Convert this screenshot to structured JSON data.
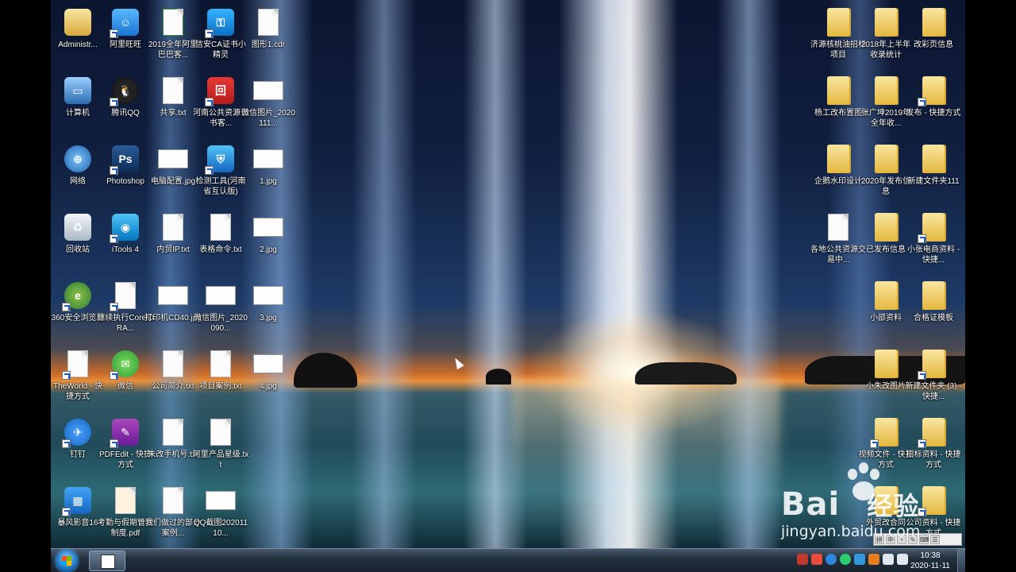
{
  "watermark": {
    "brand": "Bai",
    "brand_suffix": "经验",
    "url": "jingyan.baidu.com"
  },
  "taskbar": {
    "time": "10:38",
    "date": "2020-11-11"
  },
  "language_bar": {
    "items": [
      "拼",
      "中",
      "・",
      "✎",
      "⌨",
      "☰"
    ]
  },
  "desktop_icons": [
    {
      "label": "Administr...",
      "icon": "user-folder-icon",
      "col": 0,
      "row": 0
    },
    {
      "label": "阿里旺旺",
      "icon": "aliwangwang-icon",
      "col": 1,
      "row": 0
    },
    {
      "label": "2019全年阿里巴巴客...",
      "icon": "excel-file-icon",
      "col": 2,
      "row": 0
    },
    {
      "label": "信安CA证书小精灵",
      "icon": "key-icon",
      "col": 3,
      "row": 0
    },
    {
      "label": "图形1.cdr",
      "icon": "file-icon",
      "col": 4,
      "row": 0
    },
    {
      "label": "计算机",
      "icon": "computer-icon",
      "col": 0,
      "row": 1
    },
    {
      "label": "腾讯QQ",
      "icon": "qq-icon",
      "col": 1,
      "row": 1
    },
    {
      "label": "共享.txt",
      "icon": "text-file-icon",
      "col": 2,
      "row": 1
    },
    {
      "label": "河南公共资源证书客...",
      "icon": "certificate-app-icon",
      "col": 3,
      "row": 1
    },
    {
      "label": "微信图片_2020111...",
      "icon": "image-file-icon",
      "col": 4,
      "row": 1
    },
    {
      "label": "网络",
      "icon": "network-icon",
      "col": 0,
      "row": 2
    },
    {
      "label": "Photoshop",
      "icon": "photoshop-icon",
      "col": 1,
      "row": 2
    },
    {
      "label": "电脑配置.jpg",
      "icon": "image-file-icon",
      "col": 2,
      "row": 2
    },
    {
      "label": "检测工具(河南省互认版)",
      "icon": "shield-app-icon",
      "col": 3,
      "row": 2
    },
    {
      "label": "1.jpg",
      "icon": "image-file-icon",
      "col": 4,
      "row": 2
    },
    {
      "label": "回收站",
      "icon": "recycle-bin-icon",
      "col": 0,
      "row": 3
    },
    {
      "label": "iTools 4",
      "icon": "itools-icon",
      "col": 1,
      "row": 3
    },
    {
      "label": "内贸IP.txt",
      "icon": "text-file-icon",
      "col": 2,
      "row": 3
    },
    {
      "label": "表格命令.txt",
      "icon": "text-file-icon",
      "col": 3,
      "row": 3
    },
    {
      "label": "2.jpg",
      "icon": "image-file-icon",
      "col": 4,
      "row": 3
    },
    {
      "label": "360安全浏览器",
      "icon": "browser-360-icon",
      "col": 0,
      "row": 4
    },
    {
      "label": "继续执行CorelDRA...",
      "icon": "app-window-icon",
      "col": 1,
      "row": 4
    },
    {
      "label": "打印机CD40.jpg",
      "icon": "image-file-icon",
      "col": 2,
      "row": 4
    },
    {
      "label": "微信图片_2020090...",
      "icon": "image-file-icon",
      "col": 3,
      "row": 4
    },
    {
      "label": "3.jpg",
      "icon": "image-file-icon",
      "col": 4,
      "row": 4
    },
    {
      "label": "TheWorld - 快捷方式",
      "icon": "app-window-icon",
      "col": 0,
      "row": 5
    },
    {
      "label": "微信",
      "icon": "wechat-icon",
      "col": 1,
      "row": 5
    },
    {
      "label": "公司简介.txt",
      "icon": "text-file-icon",
      "col": 2,
      "row": 5
    },
    {
      "label": "项目案例.txt",
      "icon": "text-file-icon",
      "col": 3,
      "row": 5
    },
    {
      "label": "4.jpg",
      "icon": "image-file-icon",
      "col": 4,
      "row": 5
    },
    {
      "label": "钉钉",
      "icon": "dingtalk-icon",
      "col": 0,
      "row": 6
    },
    {
      "label": "PDFEdit - 快捷方式",
      "icon": "pdfedit-icon",
      "col": 1,
      "row": 6
    },
    {
      "label": "未改手机号.txt",
      "icon": "text-file-icon",
      "col": 2,
      "row": 6
    },
    {
      "label": "阿里产品星级.txt",
      "icon": "text-file-icon",
      "col": 3,
      "row": 6
    },
    {
      "label": "暴风影音16",
      "icon": "baofeng-icon",
      "col": 0,
      "row": 7
    },
    {
      "label": "考勤与假期管理制度.pdf",
      "icon": "pdf-file-icon",
      "col": 1,
      "row": 7
    },
    {
      "label": "我们做过的部分案例...",
      "icon": "word-file-icon",
      "col": 2,
      "row": 7
    },
    {
      "label": "QQ截图20201110...",
      "icon": "image-file-icon",
      "col": 3,
      "row": 7
    },
    {
      "label": "济源核桃油招标项目",
      "icon": "folder-icon",
      "col": 16,
      "row": 0
    },
    {
      "label": "2018年上半年收录统计",
      "icon": "folder-icon",
      "col": 17,
      "row": 0
    },
    {
      "label": "改彩页信息",
      "icon": "folder-icon",
      "col": 18,
      "row": 0
    },
    {
      "label": "杨工改布置图",
      "icon": "folder-icon",
      "col": 16,
      "row": 1
    },
    {
      "label": "张广坤2019年全年收...",
      "icon": "folder-icon",
      "col": 17,
      "row": 1
    },
    {
      "label": "发布 - 快捷方式",
      "icon": "folder-shortcut-icon",
      "col": 18,
      "row": 1
    },
    {
      "label": "企鹅水印设计",
      "icon": "folder-icon",
      "col": 16,
      "row": 2
    },
    {
      "label": "2020年发布信息",
      "icon": "folder-icon",
      "col": 17,
      "row": 2
    },
    {
      "label": "新建文件夹111",
      "icon": "folder-icon",
      "col": 18,
      "row": 2
    },
    {
      "label": "各地公共资源交易中...",
      "icon": "text-file-icon",
      "col": 16,
      "row": 3
    },
    {
      "label": "已发布信息",
      "icon": "folder-icon",
      "col": 17,
      "row": 3
    },
    {
      "label": "小张电商资料 - 快捷...",
      "icon": "folder-shortcut-icon",
      "col": 18,
      "row": 3
    },
    {
      "label": "小邵资料",
      "icon": "folder-icon",
      "col": 17,
      "row": 4
    },
    {
      "label": "合格证模板",
      "icon": "folder-icon",
      "col": 18,
      "row": 4
    },
    {
      "label": "小朱改图片",
      "icon": "folder-icon",
      "col": 17,
      "row": 5
    },
    {
      "label": "新建文件夹 (3) - 快捷...",
      "icon": "folder-shortcut-icon",
      "col": 18,
      "row": 5
    },
    {
      "label": "视频文件 - 快捷方式",
      "icon": "folder-shortcut-icon",
      "col": 17,
      "row": 6
    },
    {
      "label": "招标资料 - 快捷方式",
      "icon": "folder-shortcut-icon",
      "col": 18,
      "row": 6
    },
    {
      "label": "外贸改合同",
      "icon": "folder-icon",
      "col": 17,
      "row": 7
    },
    {
      "label": "公司资料 - 快捷方式",
      "icon": "folder-shortcut-icon",
      "col": 18,
      "row": 7
    }
  ],
  "tray_icons": [
    {
      "icon": "ime-icon",
      "color": "#c0392b"
    },
    {
      "icon": "security-icon",
      "color": "#e74c3c"
    },
    {
      "icon": "browser-icon",
      "color": "#2e86de"
    },
    {
      "icon": "wechat-tray-icon",
      "color": "#2ecc71"
    },
    {
      "icon": "shield-tray-icon",
      "color": "#3498db"
    },
    {
      "icon": "antivirus-icon",
      "color": "#e67e22"
    },
    {
      "icon": "network-tray-icon",
      "color": "#dfe6ee"
    },
    {
      "icon": "volume-icon",
      "color": "#dfe6ee"
    }
  ]
}
